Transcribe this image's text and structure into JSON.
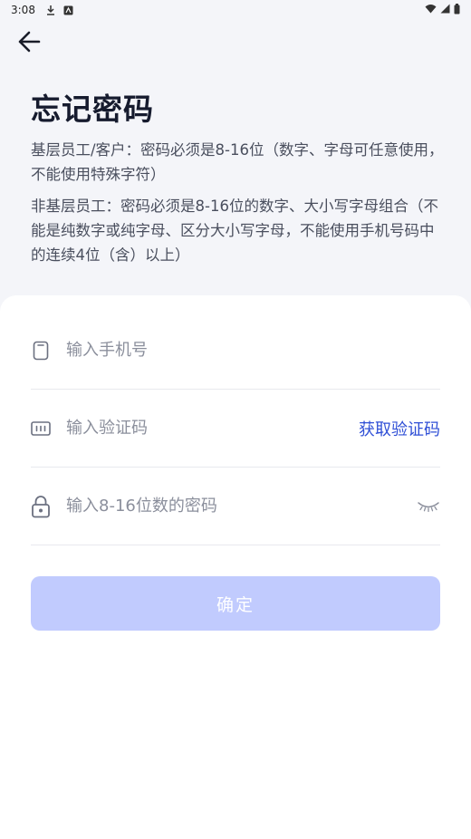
{
  "status_bar": {
    "time": "3:08",
    "left_icons": [
      "download-icon",
      "notification-icon"
    ],
    "right_icons": [
      "wifi-icon",
      "signal-icon",
      "battery-icon"
    ]
  },
  "header": {
    "back_icon": "arrow-left-icon",
    "title": "忘记密码"
  },
  "rules": {
    "rule1": "基层员工/客户：密码必须是8-16位（数字、字母可任意使用，不能使用特殊字符）",
    "rule2": "非基层员工：密码必须是8-16位的数字、大小写字母组合（不能是纯数字或纯字母、区分大小写字母，不能使用手机号码中的连续4位（含）以上）"
  },
  "form": {
    "phone": {
      "icon": "phone-icon",
      "placeholder": "输入手机号",
      "value": ""
    },
    "code": {
      "icon": "verification-code-icon",
      "placeholder": "输入验证码",
      "value": "",
      "action_label": "获取验证码"
    },
    "password": {
      "icon": "lock-icon",
      "placeholder": "输入8-16位数的密码",
      "value": "",
      "toggle_icon": "eye-closed-icon"
    }
  },
  "confirm_label": "确定",
  "colors": {
    "accent": "#2f4fd6",
    "button_disabled": "#c1cbfe",
    "page_bg": "#f4f5f9"
  }
}
